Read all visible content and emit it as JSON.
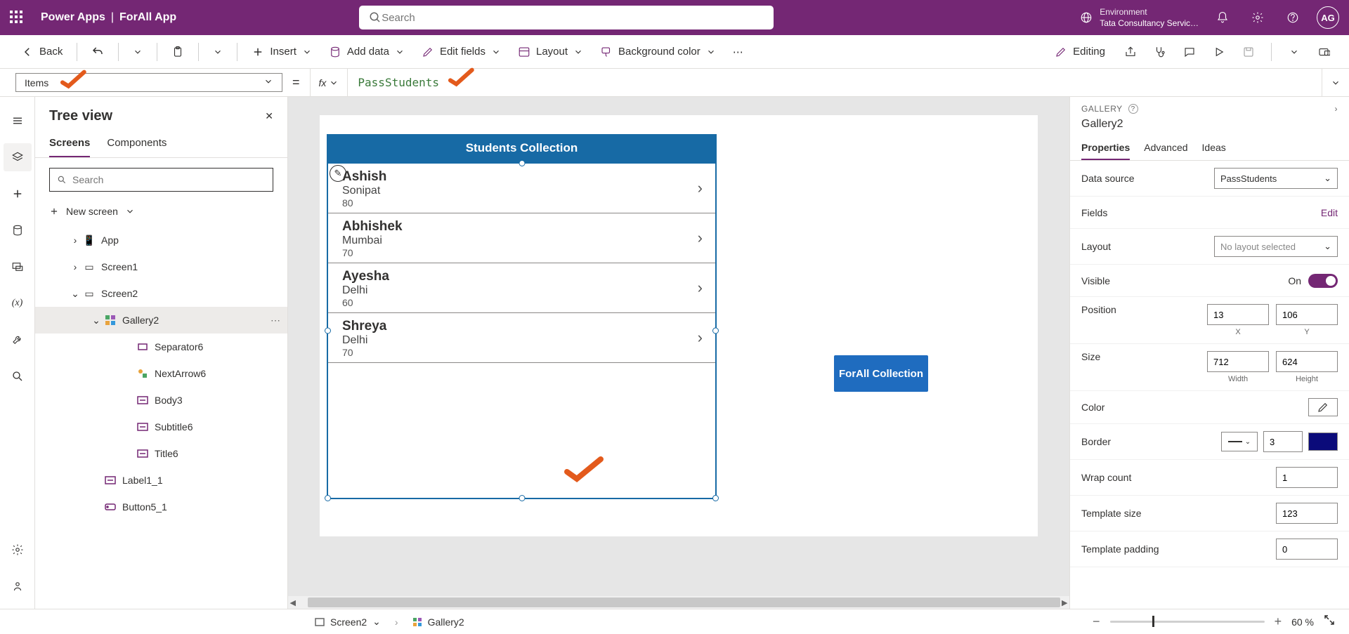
{
  "header": {
    "brand": "Power Apps",
    "app_name": "ForAll App",
    "search_placeholder": "Search",
    "env_label": "Environment",
    "env_value": "Tata Consultancy Servic…",
    "avatar": "AG"
  },
  "cmdbar": {
    "back": "Back",
    "insert": "Insert",
    "add_data": "Add data",
    "edit_fields": "Edit fields",
    "layout": "Layout",
    "bg_color": "Background color",
    "editing": "Editing"
  },
  "formula": {
    "property": "Items",
    "fx": "fx",
    "expression": "PassStudents"
  },
  "tree": {
    "title": "Tree view",
    "tab_screens": "Screens",
    "tab_components": "Components",
    "search_placeholder": "Search",
    "new_screen": "New screen",
    "nodes": {
      "app": "App",
      "screen1": "Screen1",
      "screen2": "Screen2",
      "gallery2": "Gallery2",
      "sep6": "Separator6",
      "next6": "NextArrow6",
      "body3": "Body3",
      "subtitle6": "Subtitle6",
      "title6": "Title6",
      "label11": "Label1_1",
      "button51": "Button5_1"
    }
  },
  "canvas": {
    "collection_title": "Students Collection",
    "forall_btn": "ForAll Collection",
    "items": [
      {
        "title": "Ashish",
        "sub": "Sonipat",
        "body": "80"
      },
      {
        "title": "Abhishek",
        "sub": "Mumbai",
        "body": "70"
      },
      {
        "title": "Ayesha",
        "sub": "Delhi",
        "body": "60"
      },
      {
        "title": "Shreya",
        "sub": "Delhi",
        "body": "70"
      }
    ]
  },
  "props": {
    "kind": "GALLERY",
    "name": "Gallery2",
    "tab_props": "Properties",
    "tab_adv": "Advanced",
    "tab_ideas": "Ideas",
    "data_source_lbl": "Data source",
    "data_source_val": "PassStudents",
    "fields_lbl": "Fields",
    "fields_edit": "Edit",
    "layout_lbl": "Layout",
    "layout_val": "No layout selected",
    "visible_lbl": "Visible",
    "visible_val": "On",
    "position_lbl": "Position",
    "pos_x": "13",
    "pos_y": "106",
    "pos_x_lbl": "X",
    "pos_y_lbl": "Y",
    "size_lbl": "Size",
    "size_w": "712",
    "size_h": "624",
    "size_w_lbl": "Width",
    "size_h_lbl": "Height",
    "color_lbl": "Color",
    "border_lbl": "Border",
    "border_val": "3",
    "wrap_lbl": "Wrap count",
    "wrap_val": "1",
    "tpl_size_lbl": "Template size",
    "tpl_size_val": "123",
    "tpl_pad_lbl": "Template padding",
    "tpl_pad_val": "0"
  },
  "status": {
    "crumb1": "Screen2",
    "crumb2": "Gallery2",
    "zoom": "60",
    "pct": "%"
  }
}
